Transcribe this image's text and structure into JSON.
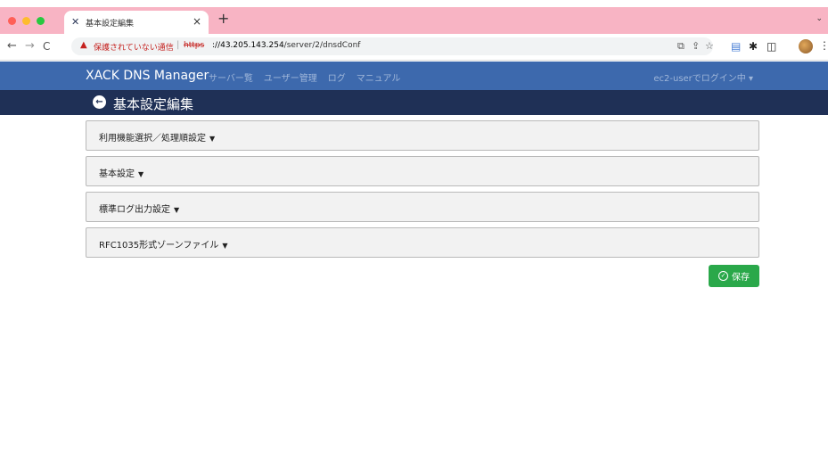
{
  "browser": {
    "tab": {
      "favicon": "x-logo-icon",
      "title": "基本設定編集",
      "close": "×"
    },
    "new_tab": "+",
    "tab_menu": "⌄",
    "nav": {
      "back": "←",
      "forward": "→",
      "reload": "C"
    },
    "omnibox": {
      "warning_icon": "▲",
      "warning_text": "保護されていない通信",
      "separator": "|",
      "scheme": "https",
      "host": "://43.205.143.254",
      "path": "/server/2/dnsdConf"
    }
  },
  "app": {
    "brand": "XACK DNS Manager",
    "nav_links": [
      "サーバー覧",
      "ユーザー管理",
      "ログ",
      "マニュアル"
    ],
    "user_menu": "ec2-userでログイン中 ▾",
    "page_title": "基本設定編集"
  },
  "panels": [
    {
      "label": "利用機能選択／処理順設定"
    },
    {
      "label": "基本設定"
    },
    {
      "label": "標準ログ出力設定"
    },
    {
      "label": "RFC1035形式ゾーンファイル"
    }
  ],
  "save_button": {
    "label": "保存"
  },
  "colors": {
    "tabbar": "#f8b4c4",
    "navbar": "#3d69ad",
    "titlebar": "#1f3056",
    "save": "#2aa84a",
    "warning": "#c5221f"
  }
}
